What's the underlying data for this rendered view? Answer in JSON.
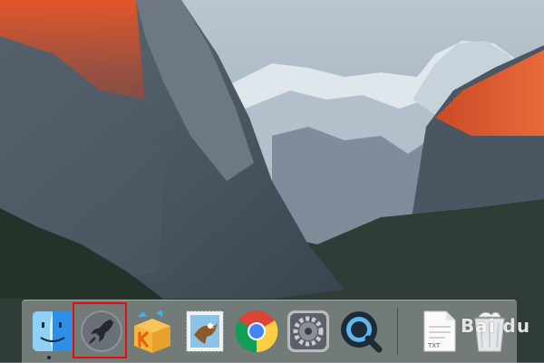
{
  "desktop": {
    "wallpaper": "yosemite-el-capitan-wallpaper"
  },
  "dock": {
    "items": [
      {
        "id": "finder",
        "icon": "finder-icon"
      },
      {
        "id": "launchpad",
        "icon": "rocket-icon",
        "highlighted": true
      },
      {
        "id": "kuaibo",
        "icon": "k-box-icon"
      },
      {
        "id": "mail",
        "icon": "eagle-stamp-icon"
      },
      {
        "id": "chrome",
        "icon": "chrome-icon"
      },
      {
        "id": "system-preferences",
        "icon": "gear-icon"
      },
      {
        "id": "quicktime",
        "icon": "quicktime-icon"
      },
      {
        "id": "document",
        "icon": "txt-file-icon",
        "label": "TXT"
      },
      {
        "id": "trash",
        "icon": "trash-icon"
      }
    ],
    "highlight_color": "#e01010"
  },
  "watermark": {
    "text": "Bai du"
  }
}
